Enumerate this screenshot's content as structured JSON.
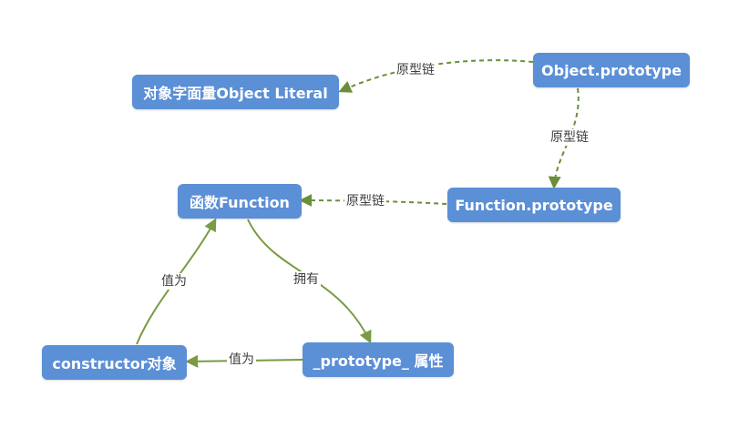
{
  "nodes": {
    "object_literal": "对象字面量Object Literal",
    "object_prototype": "Object.prototype",
    "function": "函数Function",
    "function_prototype": "Function.prototype",
    "constructor": "constructor对象",
    "prototype_attr": "_prototype_ 属性"
  },
  "edge_labels": {
    "objproto_to_literal": "原型链",
    "objproto_to_funcproto": "原型链",
    "funcproto_to_function": "原型链",
    "function_to_prototype": "拥有",
    "prototype_to_constructor": "值为",
    "constructor_to_function": "值为"
  },
  "colors": {
    "node_fill": "#5b8fd6",
    "edge_dashed": "#6b8e3a",
    "edge_solid": "#7a9a44"
  }
}
